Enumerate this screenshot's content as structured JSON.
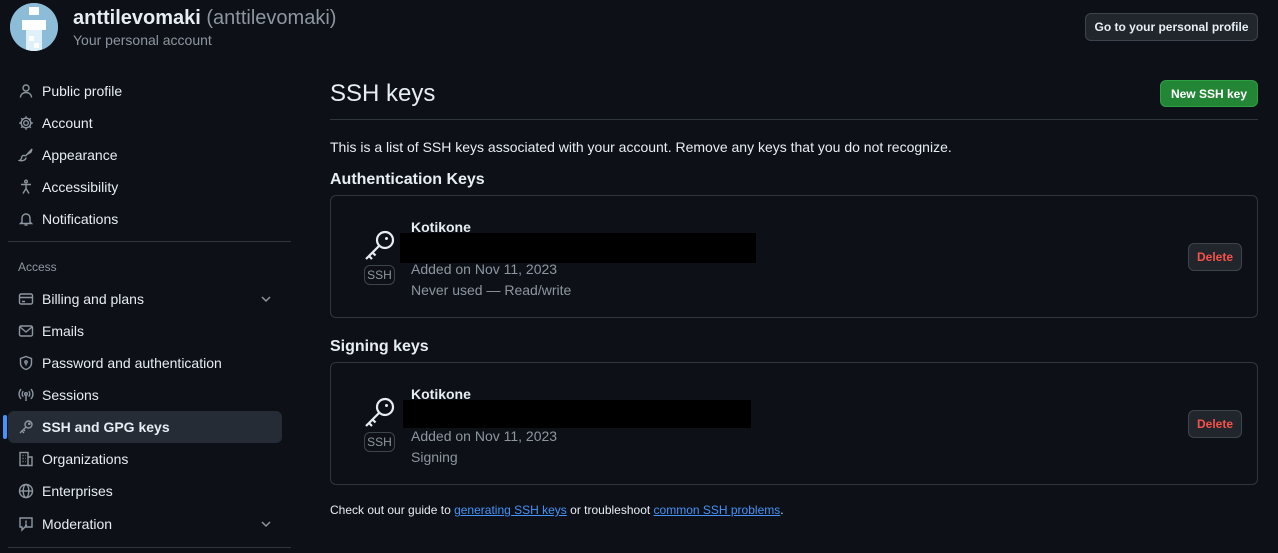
{
  "header": {
    "username": "anttilevomaki",
    "login": "(anttilevomaki)",
    "subtitle": "Your personal account",
    "profile_button": "Go to your personal profile"
  },
  "sidebar": {
    "items": [
      {
        "label": "Public profile",
        "icon": "person-icon"
      },
      {
        "label": "Account",
        "icon": "gear-icon"
      },
      {
        "label": "Appearance",
        "icon": "paintbrush-icon"
      },
      {
        "label": "Accessibility",
        "icon": "accessibility-icon"
      },
      {
        "label": "Notifications",
        "icon": "bell-icon"
      }
    ],
    "access_label": "Access",
    "access_items": [
      {
        "label": "Billing and plans",
        "icon": "credit-card-icon",
        "expandable": true
      },
      {
        "label": "Emails",
        "icon": "mail-icon"
      },
      {
        "label": "Password and authentication",
        "icon": "shield-icon"
      },
      {
        "label": "Sessions",
        "icon": "broadcast-icon"
      },
      {
        "label": "SSH and GPG keys",
        "icon": "key-icon",
        "active": true
      },
      {
        "label": "Organizations",
        "icon": "organization-icon"
      },
      {
        "label": "Enterprises",
        "icon": "globe-icon"
      },
      {
        "label": "Moderation",
        "icon": "report-icon",
        "expandable": true
      }
    ]
  },
  "main": {
    "title": "SSH keys",
    "new_button": "New SSH key",
    "intro": "This is a list of SSH keys associated with your account. Remove any keys that you do not recognize.",
    "auth_section": {
      "heading": "Authentication Keys",
      "key": {
        "name": "Kotikone",
        "badge": "SSH",
        "added": "Added on Nov 11, 2023",
        "usage": "Never used — Read/write",
        "delete_label": "Delete"
      }
    },
    "signing_section": {
      "heading": "Signing keys",
      "key": {
        "name": "Kotikone",
        "badge": "SSH",
        "added": "Added on Nov 11, 2023",
        "usage": "Signing",
        "delete_label": "Delete"
      }
    },
    "footer": {
      "prefix": "Check out our guide to ",
      "link1": "generating SSH keys",
      "middle": " or troubleshoot ",
      "link2": "common SSH problems",
      "suffix": "."
    }
  },
  "colors": {
    "background": "#0d1117",
    "accent": "#4493f8",
    "primary_button": "#238636",
    "danger": "#f85149"
  }
}
